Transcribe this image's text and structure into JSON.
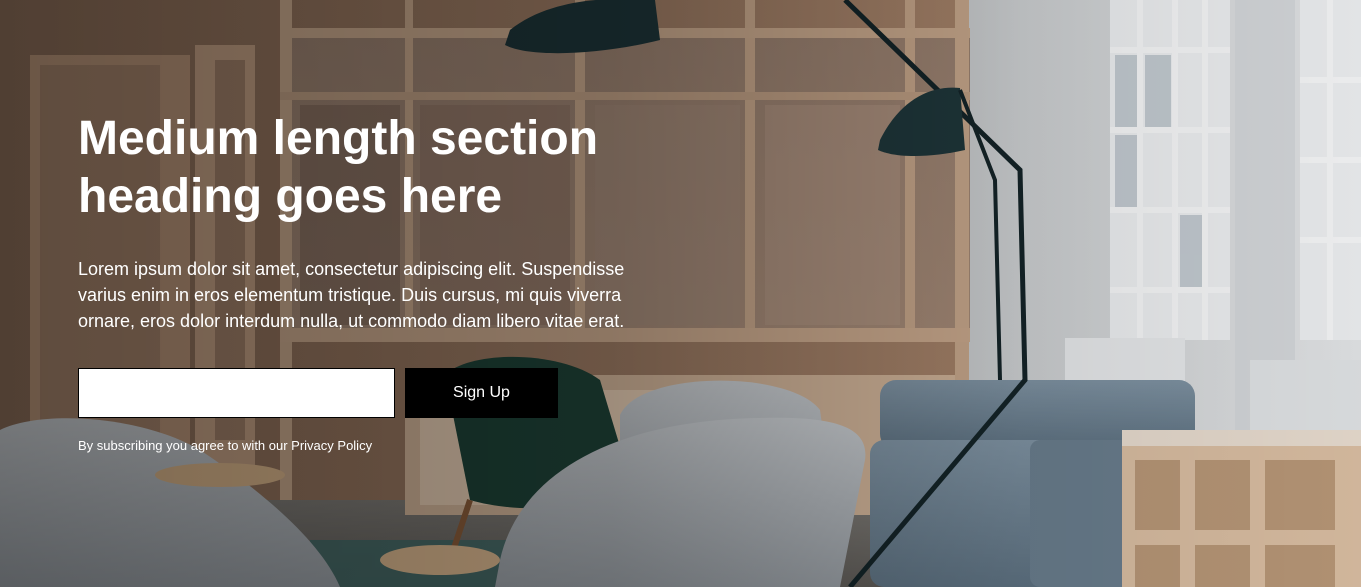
{
  "hero": {
    "heading": "Medium length section heading goes here",
    "body": "Lorem ipsum dolor sit amet, consectetur adipiscing elit. Suspendisse varius enim in eros elementum tristique. Duis cursus, mi quis viverra ornare, eros dolor interdum nulla, ut commodo diam libero vitae erat.",
    "email_placeholder": "",
    "email_value": "",
    "signup_label": "Sign Up",
    "disclaimer": "By subscribing you agree to with our Privacy Policy"
  },
  "colors": {
    "button_bg": "#000000",
    "button_text": "#ffffff",
    "heading_text": "#ffffff"
  }
}
